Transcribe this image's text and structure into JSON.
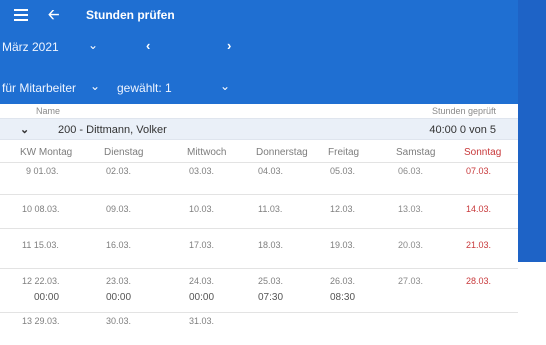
{
  "header": {
    "title": "Stunden prüfen",
    "month": "März 2021",
    "employee_label": "für Mitarbeiter",
    "selection_label": "gewählt: 1"
  },
  "table": {
    "col_name": "Name",
    "col_hours": "Stunden geprüft",
    "group": {
      "name": "200 - Dittmann, Volker",
      "hours": "40:00 0 von 5"
    },
    "day_headers": [
      "KW Montag",
      "Dienstag",
      "Mittwoch",
      "Donnerstag",
      "Freitag",
      "Samstag",
      "Sonntag"
    ],
    "weeks": [
      {
        "days": [
          "9 01.03.",
          "02.03.",
          "03.03.",
          "04.03.",
          "05.03.",
          "06.03.",
          "07.03."
        ]
      },
      {
        "days": [
          "10 08.03.",
          "09.03.",
          "10.03.",
          "11.03.",
          "12.03.",
          "13.03.",
          "14.03."
        ]
      },
      {
        "days": [
          "11 15.03.",
          "16.03.",
          "17.03.",
          "18.03.",
          "19.03.",
          "20.03.",
          "21.03."
        ]
      },
      {
        "days": [
          "12 22.03.",
          "23.03.",
          "24.03.",
          "25.03.",
          "26.03.",
          "27.03.",
          "28.03."
        ],
        "times": [
          "00:00",
          "00:00",
          "00:00",
          "07:30",
          "08:30"
        ]
      },
      {
        "days": [
          "13 29.03.",
          "30.03.",
          "31.03."
        ]
      }
    ]
  },
  "colors": {
    "header_blue": "#1f6fd2",
    "sunday_red": "#c8393b",
    "group_row_bg": "#eaf0f8"
  },
  "icons": {
    "menu": "hamburger-icon",
    "back": "arrow-left-icon",
    "dropdown": "chevron-down-icon",
    "prev": "chevron-left-icon",
    "next": "chevron-right-icon"
  }
}
